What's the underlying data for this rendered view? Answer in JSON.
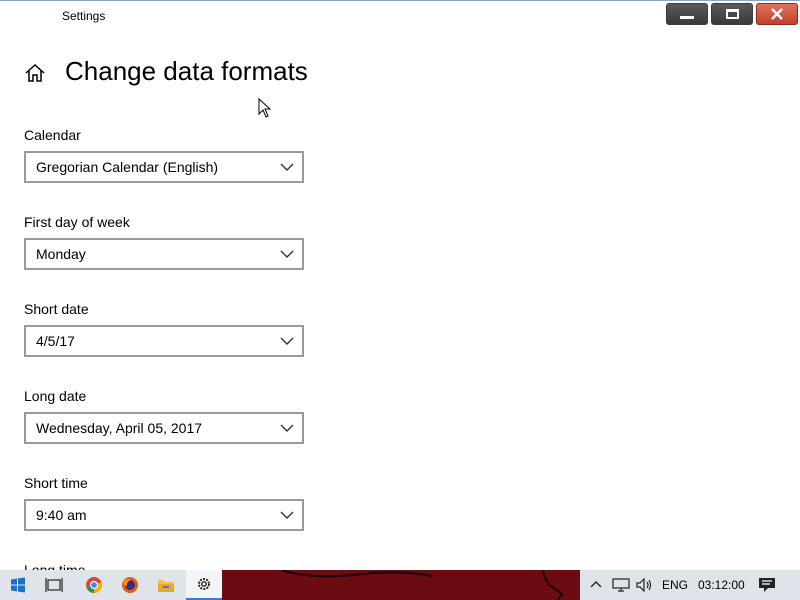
{
  "app_title": "Settings",
  "page_title": "Change data formats",
  "fields": [
    {
      "label": "Calendar",
      "value": "Gregorian Calendar (English)"
    },
    {
      "label": "First day of week",
      "value": "Monday"
    },
    {
      "label": "Short date",
      "value": "4/5/17"
    },
    {
      "label": "Long date",
      "value": "Wednesday, April 05, 2017"
    },
    {
      "label": "Short time",
      "value": "9:40 am"
    },
    {
      "label": "Long time",
      "value": ""
    }
  ],
  "taskbar": {
    "language": "ENG",
    "clock": "03:12:00",
    "icons": [
      "windows-start-icon",
      "task-view-icon",
      "chrome-icon",
      "firefox-icon",
      "file-explorer-icon",
      "settings-gear-icon"
    ],
    "tray_icons": [
      "chevron-up-icon",
      "network-icon",
      "volume-icon",
      "notification-icon"
    ]
  },
  "colors": {
    "accent": "#3b78d8",
    "close_button": "#c0402b",
    "border": "#999999",
    "taskbar": "#dfe4ea",
    "wallpaper": "#6b0b12"
  }
}
